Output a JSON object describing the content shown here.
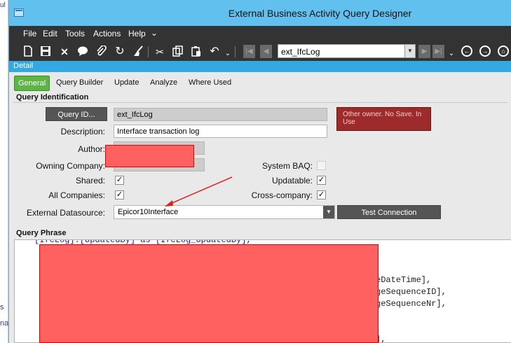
{
  "background": {
    "top_text": "ul",
    "bottom_text_1": "s",
    "bottom_text_2": "na"
  },
  "window": {
    "title": "External Business Activity Query Designer"
  },
  "menu": [
    "File",
    "Edit",
    "Tools",
    "Actions",
    "Help"
  ],
  "toolbar": {
    "icons": [
      "new-icon",
      "save-icon",
      "delete-icon",
      "comment-icon",
      "attach-icon",
      "refresh-icon",
      "clear-icon",
      "cut-icon",
      "copy-icon",
      "paste-icon",
      "undo-icon"
    ],
    "nav_value": "ext_IfcLog"
  },
  "detail_bar": {
    "label": "Detail"
  },
  "tabs": [
    {
      "label": "General",
      "active": true
    },
    {
      "label": "Query Builder",
      "active": false
    },
    {
      "label": "Update",
      "active": false
    },
    {
      "label": "Analyze",
      "active": false
    },
    {
      "label": "Where Used",
      "active": false
    }
  ],
  "query_identification": {
    "header": "Query Identification",
    "query_id_button": "Query ID...",
    "query_id_value": "ext_IfcLog",
    "status_text": "Other owner. No Save. In Use",
    "description_label": "Description:",
    "description_value": "Interface transaction log",
    "author_label": "Author:",
    "owning_company_label": "Owning Company:",
    "system_baq_label": "System BAQ:",
    "shared_label": "Shared:",
    "updatable_label": "Updatable:",
    "all_companies_label": "All Companies:",
    "cross_company_label": "Cross-company:",
    "external_datasource_label": "External Datasource:",
    "external_datasource_value": "Epicor10Interface",
    "test_connection_button": "Test Connection",
    "checks": {
      "shared": true,
      "updatable": true,
      "all_companies": true,
      "cross_company": true,
      "system_baq": false
    }
  },
  "query_phrase": {
    "header": "Query Phrase",
    "first_line": "[IfcLog].[UpdatedBy] as [IfcLog_UpdatedBy],",
    "visible_fragments": [
      "eDateTime],",
      "geSequenceID],",
      "geSequenceNr],",
      "],"
    ]
  },
  "colors": {
    "title_bar": "#62c0ee",
    "menu_bar": "#333333",
    "detail_bar": "#34a8e0",
    "active_tab": "#5fb448",
    "status_bg": "#9e2b2b",
    "redaction": "#ff6060",
    "arrow": "#e02020"
  }
}
